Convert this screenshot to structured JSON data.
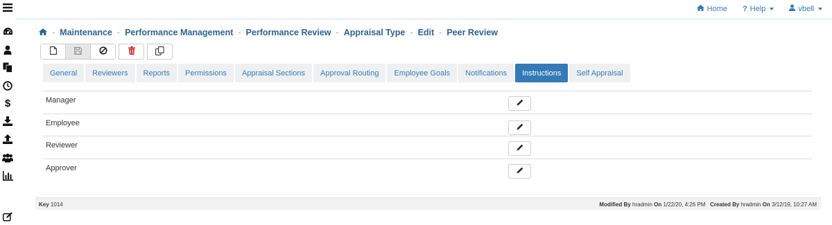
{
  "topnav": {
    "home_label": "Home",
    "help_label": "Help",
    "user_label": "vbell"
  },
  "breadcrumb": {
    "items": [
      "Maintenance",
      "Performance Management",
      "Performance Review",
      "Appraisal Type",
      "Edit",
      "Peer Review"
    ],
    "separator": "-"
  },
  "toolbar": {
    "buttons": [
      "new-icon",
      "save-icon",
      "cancel-icon",
      "delete-icon",
      "copy-icon"
    ]
  },
  "tabs": [
    {
      "label": "General",
      "active": false
    },
    {
      "label": "Reviewers",
      "active": false
    },
    {
      "label": "Reports",
      "active": false
    },
    {
      "label": "Permissions",
      "active": false
    },
    {
      "label": "Appraisal Sections",
      "active": false
    },
    {
      "label": "Approval Routing",
      "active": false
    },
    {
      "label": "Employee Goals",
      "active": false
    },
    {
      "label": "Notifications",
      "active": false
    },
    {
      "label": "Instructions",
      "active": true
    },
    {
      "label": "Self Appraisal",
      "active": false
    }
  ],
  "instructions": {
    "rows": [
      {
        "label": "Manager"
      },
      {
        "label": "Employee"
      },
      {
        "label": "Reviewer"
      },
      {
        "label": "Approver"
      }
    ]
  },
  "footer": {
    "key_label": "Key",
    "key_value": "1014",
    "modified_label": "Modified By",
    "modified_by": "hradmin",
    "modified_on_label": "On",
    "modified_on": "1/22/20, 4:26 PM",
    "created_label": "Created By",
    "created_by": "hradmin",
    "created_on_label": "On",
    "created_on": "3/12/19, 10:27 AM"
  },
  "colors": {
    "accent": "#337ab7",
    "breadcrumb": "#2a6496",
    "delete": "#c9302c",
    "tab_bg": "#eef0f2"
  },
  "sidebar": {
    "icons": [
      "menu-icon",
      "dashboard-icon",
      "person-icon",
      "documents-icon",
      "clock-icon",
      "dollar-icon",
      "download-icon",
      "upload-icon",
      "group-icon",
      "bar-chart-icon",
      "edit-icon"
    ]
  }
}
